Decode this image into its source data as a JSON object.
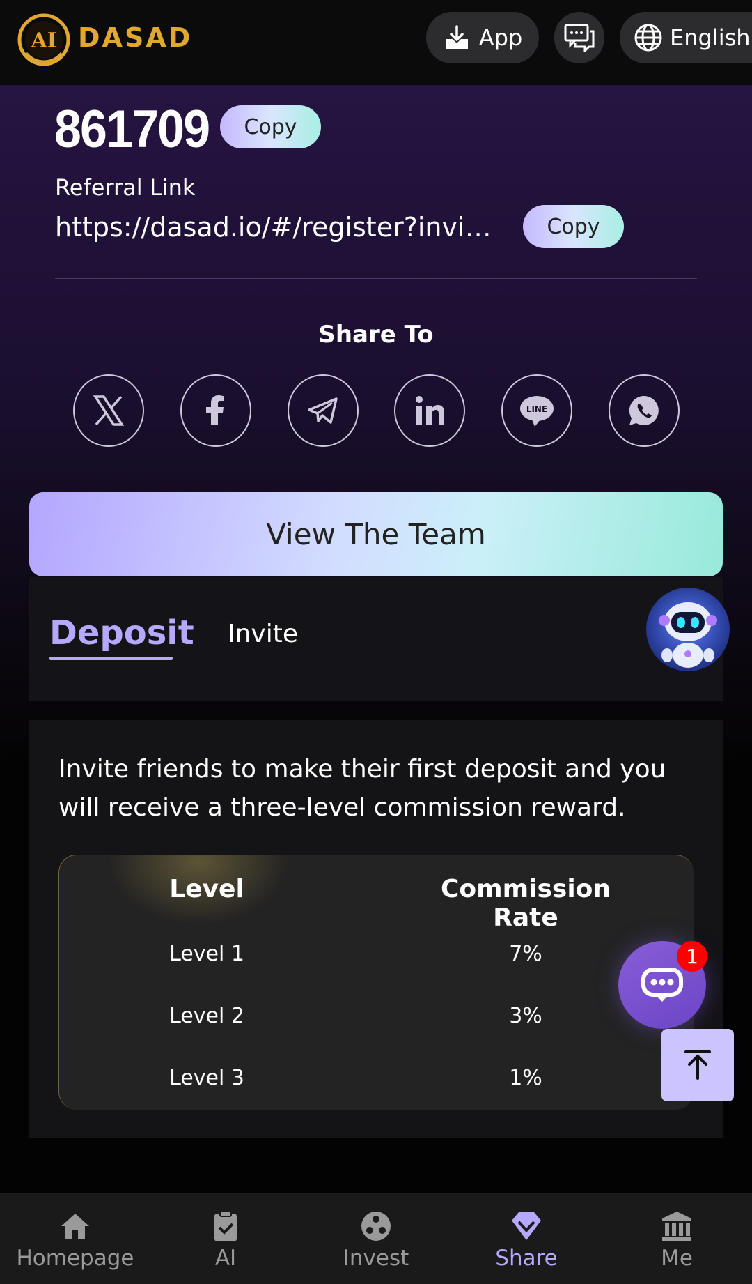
{
  "header": {
    "brand": "DASAD",
    "app_label": "App",
    "language_label": "English"
  },
  "referral": {
    "code": "861709",
    "copy_label": "Copy",
    "link_label": "Referral Link",
    "link_value": "https://dasad.io/#/register?invite…",
    "share_title": "Share To",
    "share_icons": [
      "x-icon",
      "facebook-icon",
      "telegram-icon",
      "linkedin-icon",
      "line-icon",
      "whatsapp-icon"
    ]
  },
  "team_button": "View The Team",
  "tabs": {
    "deposit": "Deposit",
    "invite": "Invite",
    "active": "Deposit"
  },
  "content": {
    "description": "Invite friends to make their first deposit and you will receive a three-level commission reward.",
    "table": {
      "headers": [
        "Level",
        "Commission Rate"
      ],
      "rows": [
        [
          "Level 1",
          "7%"
        ],
        [
          "Level 2",
          "3%"
        ],
        [
          "Level 3",
          "1%"
        ]
      ]
    }
  },
  "chat_badge": "1",
  "nav": {
    "items": [
      {
        "label": "Homepage",
        "icon": "home-icon"
      },
      {
        "label": "AI",
        "icon": "clipboard-check-icon"
      },
      {
        "label": "Invest",
        "icon": "dots-circle-icon"
      },
      {
        "label": "Share",
        "icon": "diamond-icon"
      },
      {
        "label": "Me",
        "icon": "bank-icon"
      }
    ],
    "active": "Share"
  },
  "colors": {
    "accent": "#b6a8ff",
    "brand": "#e0a830",
    "badge": "#ff0000"
  }
}
